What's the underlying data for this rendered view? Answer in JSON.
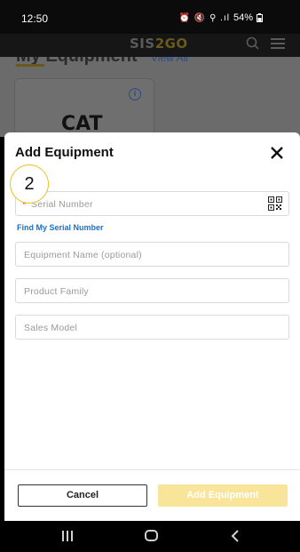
{
  "status_bar": {
    "time": "12:50",
    "battery": "54%",
    "icons": "⏰ 🔇 ⚲ .ıl"
  },
  "app_header": {
    "logo_part1": "SIS",
    "logo_part2": "2GO"
  },
  "background": {
    "section_title": "My Equipment",
    "view_all": "View All",
    "card_logo": "CAT"
  },
  "dialog": {
    "title": "Add Equipment",
    "step_number": "2",
    "serial_required_mark": "*",
    "serial_placeholder": "Serial Number",
    "find_serial_link": "Find My Serial Number",
    "equipment_name_placeholder": "Equipment Name (optional)",
    "product_family_placeholder": "Product Family",
    "sales_model_placeholder": "Sales Model",
    "cancel_label": "Cancel",
    "add_label": "Add Equipment"
  },
  "colors": {
    "accent_yellow": "#f9e59a",
    "link_blue": "#1b6fc4",
    "required_red": "#d0312d"
  },
  "icons": [
    "search-icon",
    "menu-icon",
    "info-icon",
    "close-icon",
    "qr-code-icon",
    "nav-recents-icon",
    "nav-home-icon",
    "nav-back-icon"
  ]
}
